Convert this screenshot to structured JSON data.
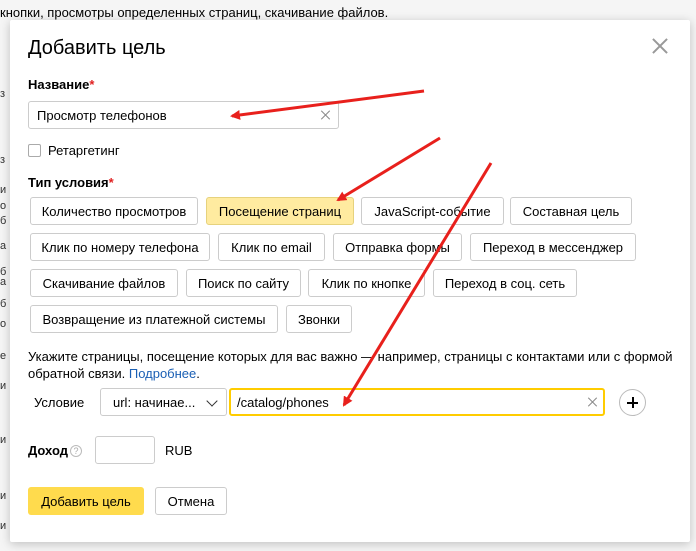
{
  "background": {
    "top_text": "кнопки, просмотры определенных страниц, скачивание файлов.",
    "left_letters": [
      "з",
      "з",
      "и",
      "о",
      "б",
      "а",
      "б",
      "а",
      "б",
      "о",
      "e",
      "и",
      "и",
      "и",
      "и"
    ]
  },
  "modal": {
    "title": "Добавить цель",
    "name_label": "Название",
    "required_mark": "*",
    "name_value": "Просмотр телефонов",
    "retargeting_label": "Ретаргетинг",
    "condition_type_label": "Тип условия",
    "condition_types": [
      "Количество просмотров",
      "Посещение страниц",
      "JavaScript-событие",
      "Составная цель",
      "Клик по номеру телефона",
      "Клик по email",
      "Отправка формы",
      "Переход в мессенджер",
      "Скачивание файлов",
      "Поиск по сайту",
      "Клик по кнопке",
      "Переход в соц. сеть",
      "Возвращение из платежной системы",
      "Звонки"
    ],
    "active_condition": "Посещение страниц",
    "hint_text": "Укажите страницы, посещение которых для вас важно — например, страницы с контактами или с формой обратной связи. ",
    "hint_link": "Подробнее",
    "hint_end": ".",
    "condition_label": "Условие",
    "condition_select": "url: начинае...",
    "url_value": "/catalog/phones",
    "income_label": "Доход",
    "help_mark": "?",
    "currency": "RUB",
    "submit_label": "Добавить цель",
    "cancel_label": "Отмена"
  },
  "colors": {
    "active_chip": "#ffeba0",
    "submit": "#ffdb4d",
    "arrow": "#e8201c",
    "focus": "#ffcc00"
  }
}
